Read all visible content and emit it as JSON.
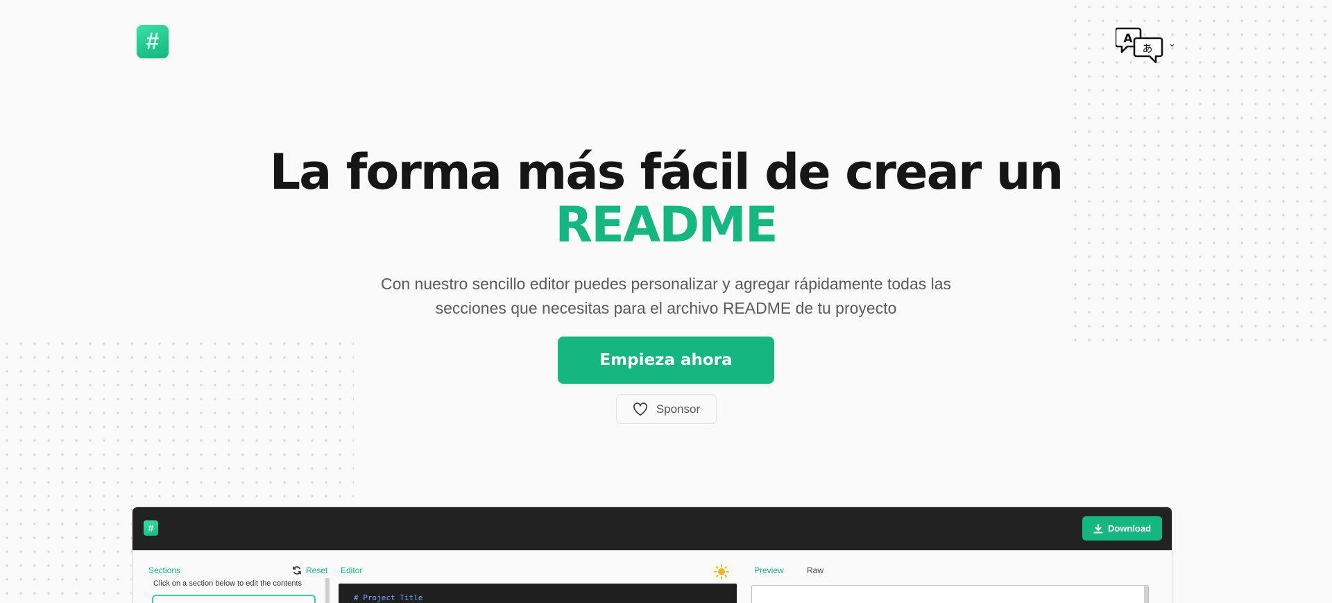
{
  "header": {
    "logo_glyph": "#",
    "language_icon": "translate-icon",
    "language_chevron": "⌄"
  },
  "hero": {
    "title_line1": "La forma más fácil de crear un",
    "title_highlight": "README",
    "subtitle_line1": "Con nuestro sencillo editor puedes personalizar y agregar rápidamente todas las",
    "subtitle_line2": "secciones que necesitas para el archivo README de tu proyecto",
    "cta_label": "Empieza ahora",
    "sponsor_label": "Sponsor",
    "sponsor_icon": "heart-icon"
  },
  "app_preview": {
    "logo_glyph": "#",
    "download_label": "Download",
    "sections_label": "Sections",
    "reset_label": "Reset",
    "sections_hint": "Click on a section below to edit the contents",
    "editor_label": "Editor",
    "code_line": "# Project Title",
    "preview_tab": "Preview",
    "raw_tab": "Raw"
  },
  "colors": {
    "accent": "#15b67f",
    "title": "#161616",
    "subtitle": "#5b5b5b",
    "background": "#fafafa",
    "preview_topbar": "#222222"
  }
}
